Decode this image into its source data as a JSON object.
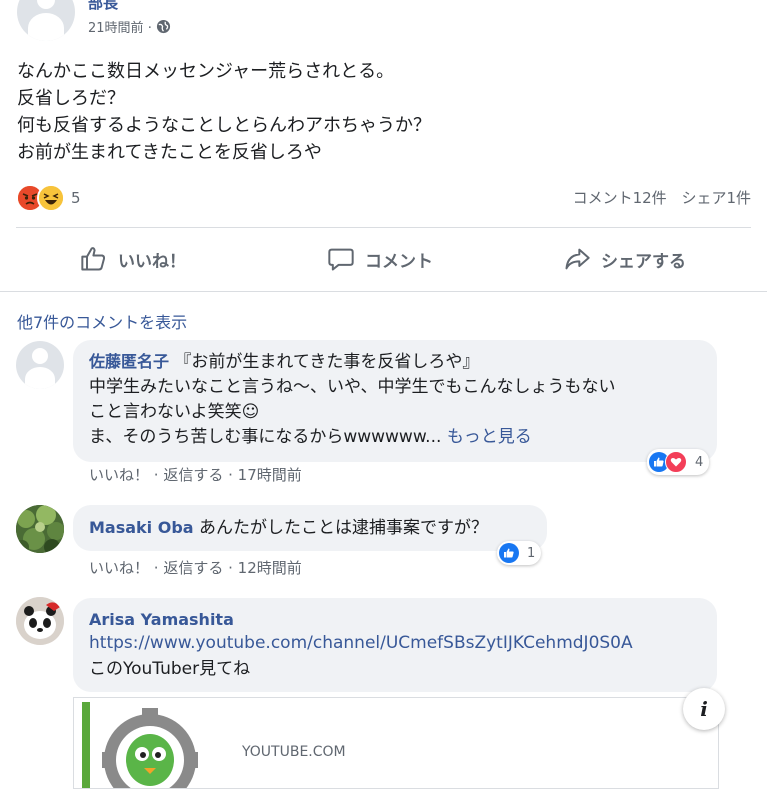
{
  "post": {
    "author": "部長",
    "time": "21時間前",
    "privacy_icon": "globe-icon",
    "text_lines": [
      "なんかここ数日メッセンジャー荒らされとる。",
      "反省しろだ？",
      "何も反省するようなことしとらんわアホちゃうか？",
      "お前が生まれてきたことを反省しろや"
    ],
    "reaction_icons": [
      "angry-emoji-icon",
      "haha-emoji-icon"
    ],
    "reaction_count": "5",
    "comment_count": "コメント12件",
    "share_count": "シェア1件"
  },
  "actions": {
    "like": "いいね！",
    "comment": "コメント",
    "share": "シェアする"
  },
  "more_comments": "他7件のコメントを表示",
  "comments": [
    {
      "name": "佐藤匿名子",
      "first_line": " 『お前が生まれてきた事を反省しろや』",
      "lines": [
        "中学生みたいなこと言うね〜、いや、中学生でもこんなしょうもない",
        "こと言わないよ笑笑☺"
      ],
      "last_line": "ま、そのうち苦しむ事になるからwwwwww...",
      "more": "もっと見る",
      "like": "いいね！",
      "reply": "返信する",
      "time": "17時間前",
      "reaction_count": "4"
    },
    {
      "name": "Masaki Oba",
      "text": " あんたがしたことは逮捕事案ですが？",
      "like": "いいね！",
      "reply": "返信する",
      "time": "12時間前",
      "reaction_count": "1"
    },
    {
      "name": "Arisa Yamashita",
      "url": "https://www.youtube.com/channel/UCmefSBsZytIJKCehmdJ0S0A",
      "text": "このYouTuber見てね"
    }
  ],
  "preview": {
    "domain": "YOUTUBE.COM"
  },
  "colors": {
    "link": "#385898",
    "bubble": "#f0f2f5",
    "like_blue": "#1877f2",
    "love_red": "#f33e58"
  }
}
